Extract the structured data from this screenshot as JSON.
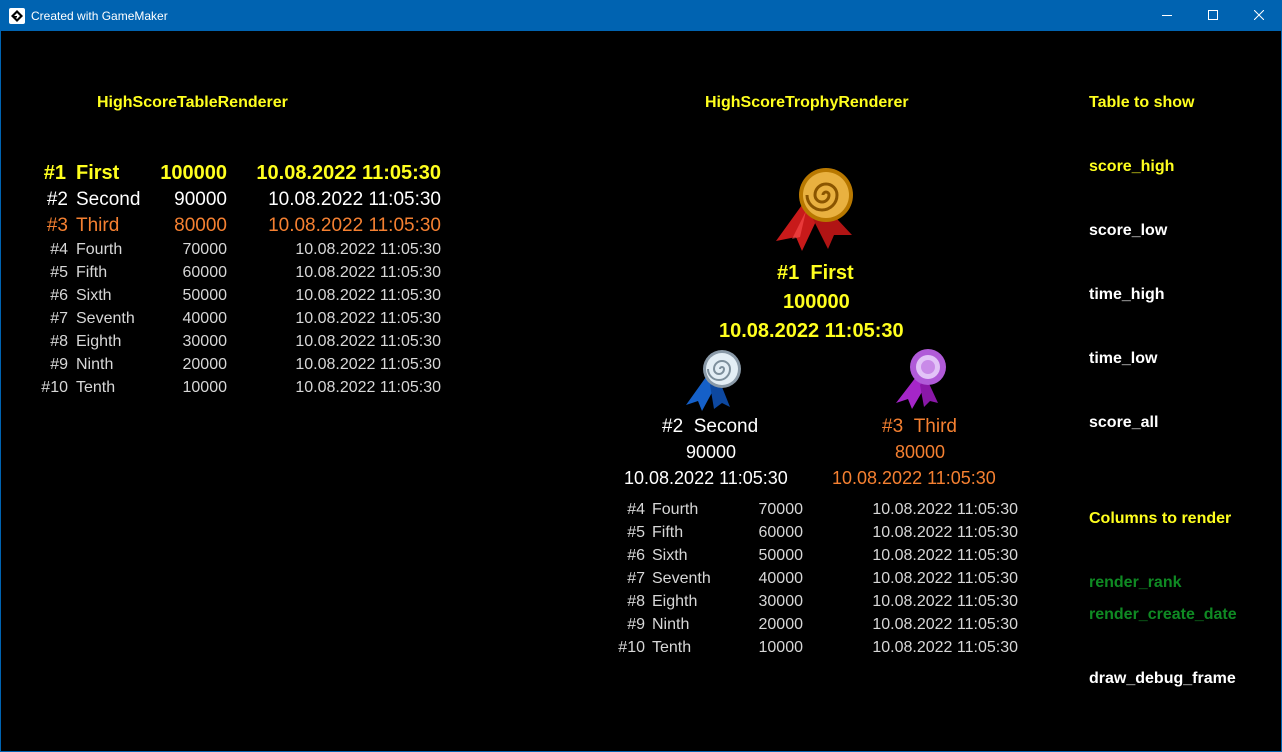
{
  "window": {
    "title": "Created with GameMaker",
    "app_icon": "gamemaker-logo-icon",
    "controls": {
      "minimize_icon": "minimize-icon",
      "maximize_icon": "maximize-icon",
      "close_icon": "close-icon"
    }
  },
  "table_renderer": {
    "heading": "HighScoreTableRenderer",
    "rows": [
      {
        "rank": "#1",
        "name": "First",
        "score": "100000",
        "date": "10.08.2022 11:05:30"
      },
      {
        "rank": "#2",
        "name": "Second",
        "score": "90000",
        "date": "10.08.2022 11:05:30"
      },
      {
        "rank": "#3",
        "name": "Third",
        "score": "80000",
        "date": "10.08.2022 11:05:30"
      },
      {
        "rank": "#4",
        "name": "Fourth",
        "score": "70000",
        "date": "10.08.2022 11:05:30"
      },
      {
        "rank": "#5",
        "name": "Fifth",
        "score": "60000",
        "date": "10.08.2022 11:05:30"
      },
      {
        "rank": "#6",
        "name": "Sixth",
        "score": "50000",
        "date": "10.08.2022 11:05:30"
      },
      {
        "rank": "#7",
        "name": "Seventh",
        "score": "40000",
        "date": "10.08.2022 11:05:30"
      },
      {
        "rank": "#8",
        "name": "Eighth",
        "score": "30000",
        "date": "10.08.2022 11:05:30"
      },
      {
        "rank": "#9",
        "name": "Ninth",
        "score": "20000",
        "date": "10.08.2022 11:05:30"
      },
      {
        "rank": "#10",
        "name": "Tenth",
        "score": "10000",
        "date": "10.08.2022 11:05:30"
      }
    ]
  },
  "trophy_renderer": {
    "heading": "HighScoreTrophyRenderer",
    "first": {
      "rank": "#1",
      "name": "First",
      "score": "100000",
      "date": "10.08.2022 11:05:30",
      "icon": "gold-medal-icon"
    },
    "second": {
      "rank": "#2",
      "name": "Second",
      "score": "90000",
      "date": "10.08.2022 11:05:30",
      "icon": "silver-medal-icon"
    },
    "third": {
      "rank": "#3",
      "name": "Third",
      "score": "80000",
      "date": "10.08.2022 11:05:30",
      "icon": "purple-medal-icon"
    },
    "rest": [
      {
        "rank": "#4",
        "name": "Fourth",
        "score": "70000",
        "date": "10.08.2022 11:05:30"
      },
      {
        "rank": "#5",
        "name": "Fifth",
        "score": "60000",
        "date": "10.08.2022 11:05:30"
      },
      {
        "rank": "#6",
        "name": "Sixth",
        "score": "50000",
        "date": "10.08.2022 11:05:30"
      },
      {
        "rank": "#7",
        "name": "Seventh",
        "score": "40000",
        "date": "10.08.2022 11:05:30"
      },
      {
        "rank": "#8",
        "name": "Eighth",
        "score": "30000",
        "date": "10.08.2022 11:05:30"
      },
      {
        "rank": "#9",
        "name": "Ninth",
        "score": "20000",
        "date": "10.08.2022 11:05:30"
      },
      {
        "rank": "#10",
        "name": "Tenth",
        "score": "10000",
        "date": "10.08.2022 11:05:30"
      }
    ]
  },
  "options": {
    "table_heading": "Table to show",
    "tables": [
      {
        "label": "score_high",
        "selected": true
      },
      {
        "label": "score_low",
        "selected": false
      },
      {
        "label": "time_high",
        "selected": false
      },
      {
        "label": "time_low",
        "selected": false
      },
      {
        "label": "score_all",
        "selected": false
      }
    ],
    "columns_heading": "Columns to render",
    "columns": [
      {
        "label": "render_rank",
        "enabled": true
      },
      {
        "label": "render_create_date",
        "enabled": true
      }
    ],
    "debug_label": "draw_debug_frame",
    "colors": {
      "heading": "#ffff1e",
      "selected": "#ffff1e",
      "unselected": "#ffffff",
      "enabled": "#0f8a23",
      "disabled": "#ffffff"
    }
  },
  "colors": {
    "first": "#ffff1e",
    "second": "#ffffff",
    "third": "#f58031",
    "rest": "#d7d7d7",
    "titlebar": "#0063b1",
    "background": "#000000"
  }
}
